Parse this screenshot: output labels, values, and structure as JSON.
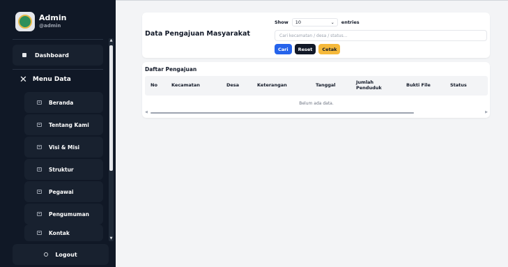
{
  "sidebar": {
    "profile": {
      "name": "Admin",
      "handle": "@admin"
    },
    "dashboard_label": "Dashboard",
    "menu_data_label": "Menu Data",
    "items": [
      {
        "label": "Beranda"
      },
      {
        "label": "Tentang Kami"
      },
      {
        "label": "Visi & Misi"
      },
      {
        "label": "Struktur"
      },
      {
        "label": "Pegawai"
      },
      {
        "label": "Pengumuman"
      },
      {
        "label": "Kontak"
      }
    ],
    "logout_label": "Logout"
  },
  "header": {
    "title": "Data Pengajuan Masyarakat",
    "show_label": "Show",
    "entries_value": "10",
    "entries_label": "entries",
    "search_placeholder": "Cari kecamatan / desa / status...",
    "buttons": {
      "cari": "Cari",
      "reset": "Reset",
      "cetak": "Cetak"
    }
  },
  "list": {
    "title": "Daftar Pengajuan",
    "columns": [
      "No",
      "Kecamatan",
      "Desa",
      "Keterangan",
      "Tanggal",
      "Jumlah Penduduk",
      "Bukti File",
      "Status"
    ],
    "empty_text": "Belum ada data."
  },
  "colors": {
    "sidebar_bg": "#101826",
    "accent_blue": "#2563eb",
    "accent_yellow": "#f5b93b"
  }
}
